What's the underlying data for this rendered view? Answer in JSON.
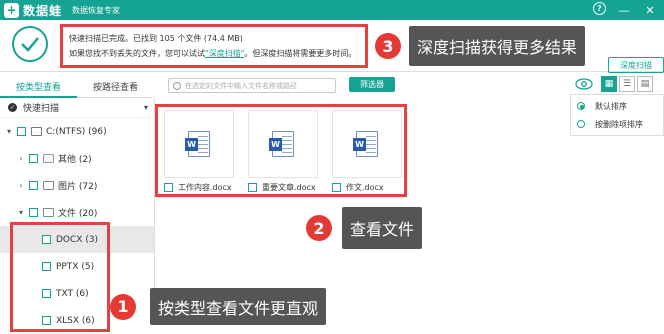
{
  "app": {
    "name": "数据蛙",
    "subtitle": "数据恢复专家",
    "logo_icon": "frog-plus-icon"
  },
  "window": {
    "help_icon": "help-icon",
    "minimize_icon": "minimize-icon",
    "close_icon": "close-icon"
  },
  "info": {
    "line1": "快速扫描已完成。已找到 105 个文件 (74.4 MB)",
    "line2_prefix": "如果您找不到丢失的文件，您可以试试",
    "line2_link": "\"深度扫描\"",
    "line2_suffix": "。但深度扫描将需要更多时间。",
    "deep_scan_button": "深度扫描"
  },
  "tabs": [
    {
      "label": "按类型查看",
      "active": true
    },
    {
      "label": "按路径查看",
      "active": false
    }
  ],
  "scan_mode": {
    "label": "快速扫描"
  },
  "search": {
    "placeholder": "在选定的文件中输入文件名称或路径"
  },
  "filter_button": "筛选器",
  "sort": {
    "options": [
      {
        "label": "默认排序",
        "selected": true
      },
      {
        "label": "按删除项排序",
        "selected": false
      }
    ]
  },
  "tree": [
    {
      "label": "C:(NTFS) (96)",
      "level": 0,
      "arrow": "▾",
      "icon": "drive-icon"
    },
    {
      "label": "其他 (2)",
      "level": 1,
      "arrow": "›",
      "icon": "folder-icon"
    },
    {
      "label": "图片 (72)",
      "level": 1,
      "arrow": "›",
      "icon": "image-icon"
    },
    {
      "label": "文件 (20)",
      "level": 1,
      "arrow": "▾",
      "icon": "document-icon"
    },
    {
      "label": "DOCX (3)",
      "level": 2,
      "arrow": "",
      "icon": "",
      "selected": true
    },
    {
      "label": "PPTX (5)",
      "level": 2,
      "arrow": "",
      "icon": ""
    },
    {
      "label": "TXT (6)",
      "level": 2,
      "arrow": "",
      "icon": ""
    },
    {
      "label": "XLSX (6)",
      "level": 2,
      "arrow": "",
      "icon": ""
    }
  ],
  "files": [
    {
      "name": "工作内容.docx",
      "icon": "word-doc-icon"
    },
    {
      "name": "重要文章.docx",
      "icon": "word-doc-icon"
    },
    {
      "name": "作文.docx",
      "icon": "word-doc-icon"
    }
  ],
  "callouts": [
    {
      "number": "1",
      "text": "按类型查看文件更直观"
    },
    {
      "number": "2",
      "text": "查看文件"
    },
    {
      "number": "3",
      "text": "深度扫描获得更多结果"
    }
  ],
  "colors": {
    "accent": "#15a394",
    "highlight_red": "#e64040",
    "callout_bg": "#555555"
  }
}
